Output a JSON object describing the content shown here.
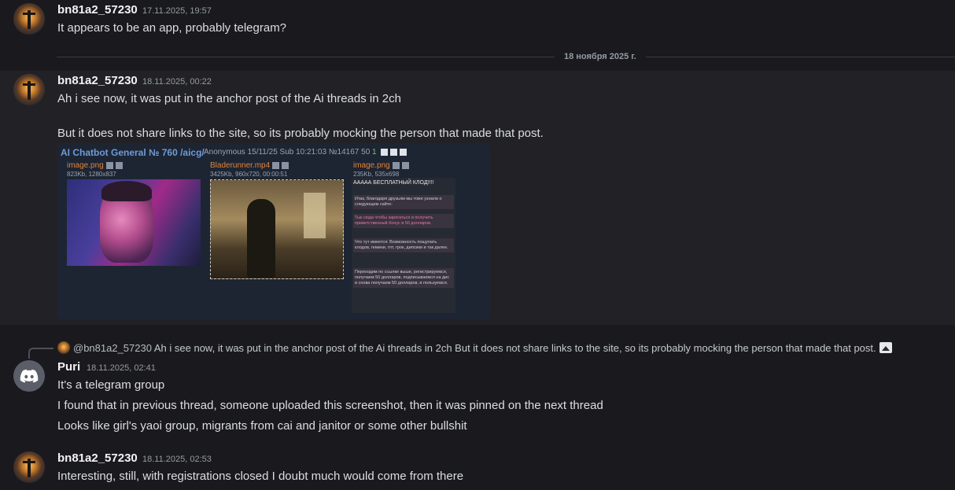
{
  "messages": [
    {
      "author": "bn81a2_57230",
      "timestamp": "17.11.2025, 19:57",
      "lines": [
        "It appears to be an app, probably telegram?"
      ]
    },
    {
      "author": "bn81a2_57230",
      "timestamp": "18.11.2025, 00:22",
      "lines": [
        "Ah i see now, it was put in the anchor post of the Ai threads in 2ch",
        "But it does not share links to the site, so its probably mocking the person that made that post."
      ]
    },
    {
      "author": "Puri",
      "timestamp": "18.11.2025, 02:41",
      "lines": [
        "It's a telegram group",
        "I found that in previous thread, someone uploaded this screenshot, then it was pinned on the next thread",
        "Looks like girl's yaoi group, migrants from cai and janitor or some other bullshit"
      ]
    },
    {
      "author": "bn81a2_57230",
      "timestamp": "18.11.2025, 02:53",
      "lines": [
        "Interesting, still, with registrations closed I doubt much would come from there"
      ]
    }
  ],
  "date_divider": "18 ноября 2025 г.",
  "embed": {
    "title": "AI Chatbot General № 760 /aicg/",
    "meta": "Anonymous 15/11/25 Sub 10:21:03 №14167 50",
    "meta_count": "1",
    "files": [
      {
        "name": "image.png",
        "info": "823Kb, 1280x837"
      },
      {
        "name": "Bladerunner.mp4",
        "info": "3425Kb, 960x720, 00:00:51"
      },
      {
        "name": "image.png",
        "info": "235Kb, 535x698"
      }
    ],
    "screenshot_header": "ААААА БЕСПЛАТНЫЙ КЛОД!!!!",
    "screenshot_boxes": [
      "Итак, благодаря друзьям мы тоже узнали о следующем сайте:",
      "Тык сюда чтобы зарегаться и получить приветственный бонус в 50 долларов.",
      "Что тут имеется: Возможность пощупать клодов, гемини, гпт, грок, дипсики и так далее.",
      "Переходим по ссылке выше, регистрируемся, получаем 50 долларов, подписываемся на дис и снова получаем 50 долларов, и пользуемся."
    ]
  },
  "reply": {
    "mention": "@bn81a2_57230",
    "text": "Ah i see now, it was put in the anchor post of the Ai threads in 2ch  But it does not share links to the site, so its probably mocking the person that made that post."
  },
  "icons": {
    "reply_attachment": "image-icon",
    "puri_avatar": "discord-logo-icon"
  },
  "colors": {
    "background": "#1a1a1e",
    "highlight": "#222226",
    "embed_bg": "#1d2533",
    "link_blue": "#6f9bd6",
    "file_orange": "#e2843b"
  }
}
